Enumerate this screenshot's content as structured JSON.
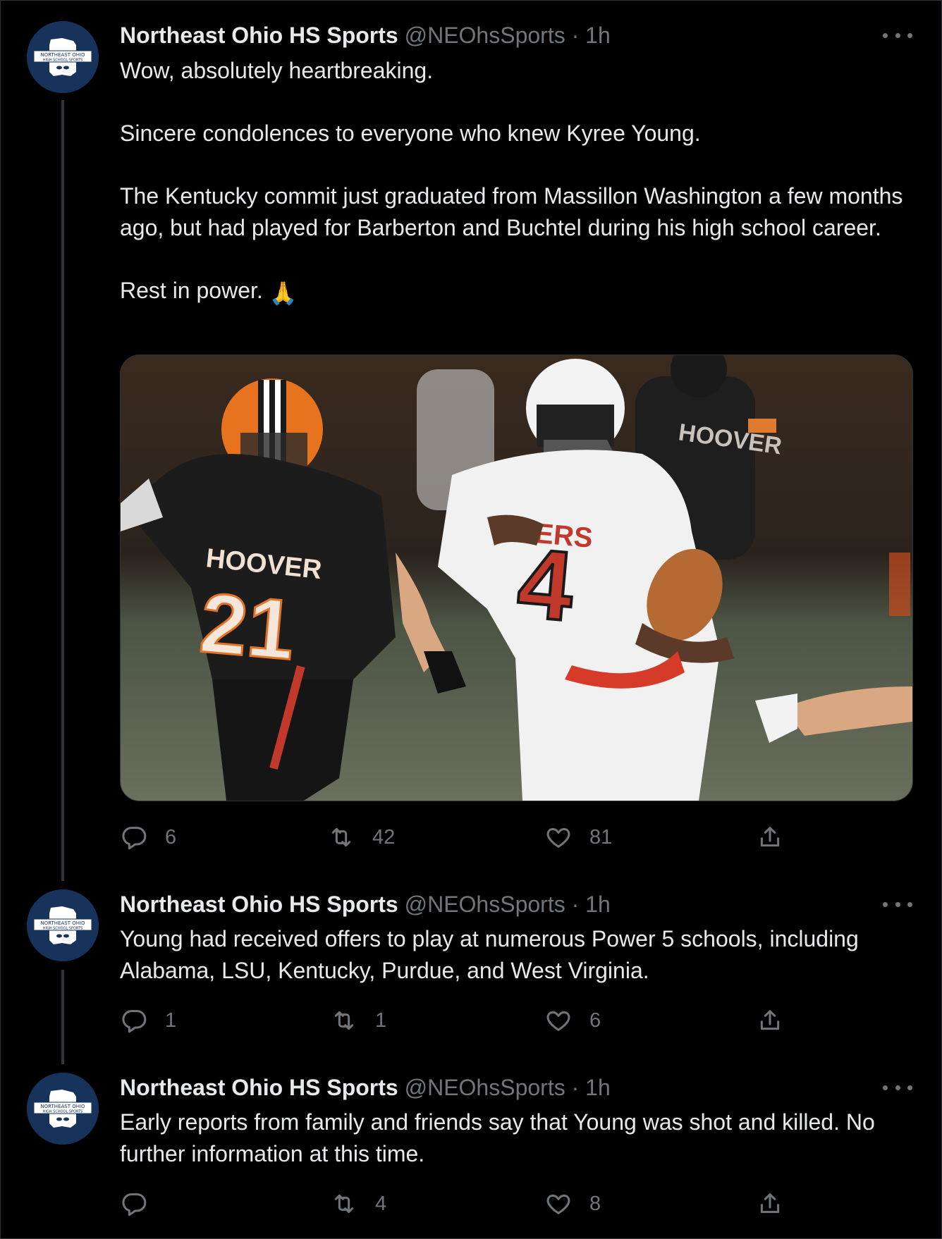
{
  "colors": {
    "background": "#000000",
    "text": "#e7e9ea",
    "muted": "#71767b",
    "border": "#2f3336",
    "avatar_bg": "#17335c"
  },
  "avatar": {
    "logo_text_line1": "NORTHEAST OHIO",
    "logo_text_line2": "HIGH SCHOOL SPORTS"
  },
  "tweets": [
    {
      "name": "Northeast Ohio HS Sports",
      "handle": "@NEOhsSports",
      "time": "· 1h",
      "paragraphs": [
        "Wow, absolutely heartbreaking.",
        "Sincere condolences to everyone who knew Kyree Young.",
        "The Kentucky commit just graduated from Massillon Washington a few months ago, but had played for Barberton and Buchtel during his high school career.",
        "Rest in power."
      ],
      "emoji": "🙏",
      "media": {
        "description_icon": "football-photo",
        "jersey_left_text": "HOOVER",
        "jersey_left_number": "21",
        "jersey_right_number": "4",
        "jersey_right_text": "TIGERS"
      },
      "replies": "6",
      "retweets": "42",
      "likes": "81"
    },
    {
      "name": "Northeast Ohio HS Sports",
      "handle": "@NEOhsSports",
      "time": "· 1h",
      "text": "Young had received offers to play at numerous Power 5 schools, including Alabama, LSU, Kentucky, Purdue, and West Virginia.",
      "replies": "1",
      "retweets": "1",
      "likes": "6"
    },
    {
      "name": "Northeast Ohio HS Sports",
      "handle": "@NEOhsSports",
      "time": "· 1h",
      "text": "Early reports from family and friends say that Young was shot and killed. No further information at this time.",
      "replies": "",
      "retweets": "4",
      "likes": "8"
    }
  ],
  "icons": {
    "reply": "reply-icon",
    "retweet": "retweet-icon",
    "like": "heart-icon",
    "share": "share-icon",
    "more": "more-icon"
  }
}
